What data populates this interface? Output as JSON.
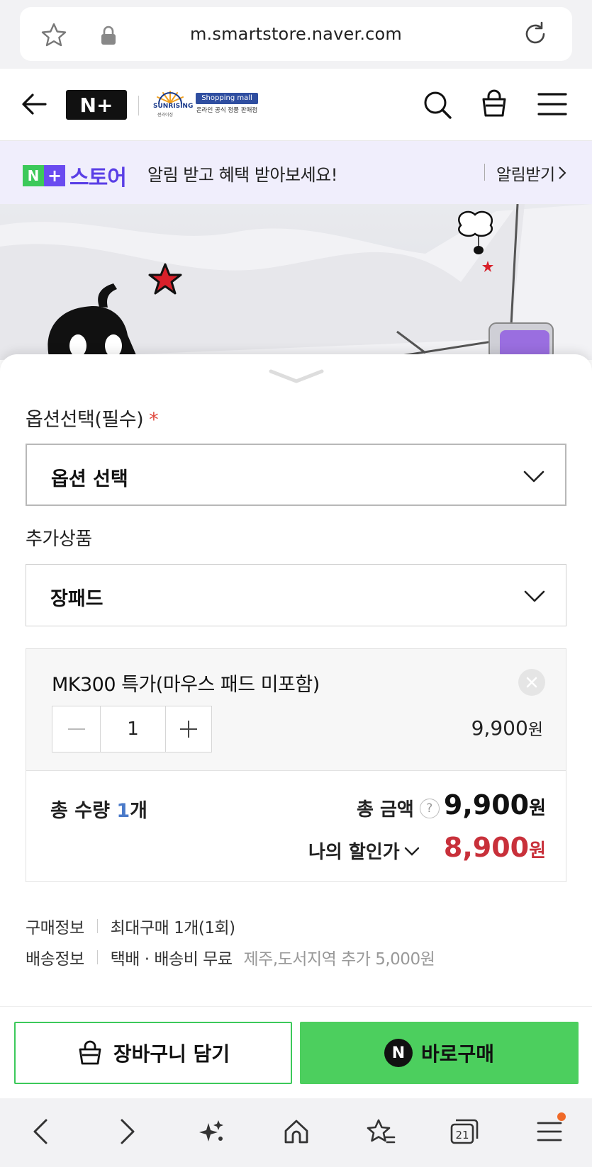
{
  "browser": {
    "url": "m.smartstore.naver.com",
    "tab_count": "21"
  },
  "header": {
    "logo": "N+",
    "brand_name": "SUNRISING",
    "brand_sub": "썬라이징",
    "brand_badge": "Shopping mall",
    "brand_badge_sub": "온라인 공식 정품 판매점"
  },
  "alert_banner": {
    "logo_n": "N",
    "logo_plus": "+",
    "logo_text": "스토어",
    "text": "알림 받고 혜택 받아보세요!",
    "button_label": "알림받기"
  },
  "options": {
    "label": "옵션선택(필수)",
    "required_mark": "*",
    "select_value": "옵션 선택",
    "addon_label": "추가상품",
    "addon_value": "장패드"
  },
  "selected_item": {
    "name": "MK300 특가(마우스 패드 미포함)",
    "quantity": "1",
    "price": "9,900",
    "currency": "원"
  },
  "summary": {
    "qty_label": "총 수량",
    "qty_value": "1",
    "qty_unit": "개",
    "total_label": "총 금액",
    "total_value": "9,900",
    "discount_label": "나의 할인가",
    "discount_value": "8,900",
    "currency": "원"
  },
  "info": {
    "purchase_key": "구매정보",
    "purchase_value": "최대구매 1개(1회)",
    "shipping_key": "배송정보",
    "shipping_value": "택배 · 배송비 무료",
    "shipping_extra": "제주,도서지역 추가 5,000원"
  },
  "actions": {
    "cart_label": "장바구니 담기",
    "buy_label": "바로구매",
    "npay_mark": "N"
  },
  "colors": {
    "accent_green": "#4ccf5e",
    "discount_red": "#c8303a",
    "store_purple": "#5a3fe6",
    "banner_bg": "#f0eefc"
  }
}
